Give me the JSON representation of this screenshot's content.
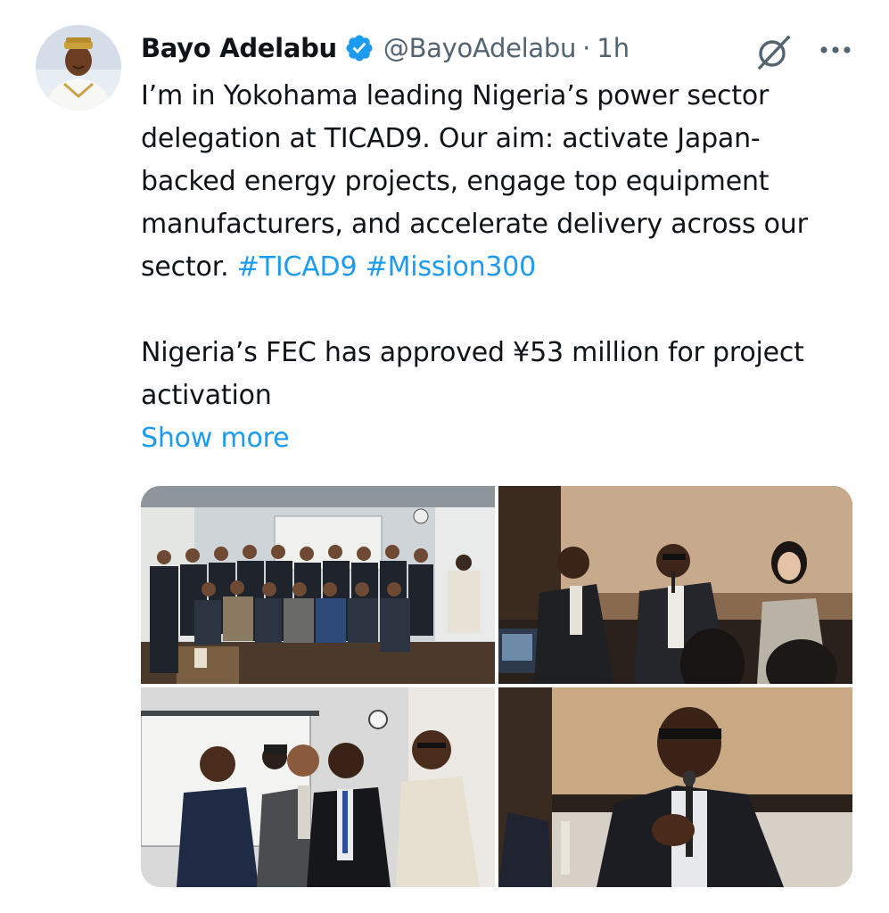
{
  "author": {
    "name": "Bayo Adelabu",
    "handle": "@BayoAdelabu",
    "separator": "·",
    "time": "1h",
    "avatar_icon": "profile-photo",
    "verified_icon": "verified-badge-icon"
  },
  "colors": {
    "accent": "#1d9bf0",
    "text": "#0f1419",
    "muted": "#536471"
  },
  "tweet": {
    "paragraph1_text": "I’m in Yokohama leading Nigeria’s power sector delegation at TICAD9. Our aim: activate Japan-backed energy projects, engage top equipment manufacturers, and accelerate delivery across our sector. ",
    "hashtags": [
      "#TICAD9",
      "#Mission300"
    ],
    "paragraph2": "Nigeria’s FEC has approved ¥53 million for project activation",
    "show_more": "Show more"
  },
  "actions": {
    "grok_icon": "grok-icon",
    "more_icon": "more-options-icon"
  },
  "media": {
    "count": 4,
    "photos": [
      {
        "name": "group-photo",
        "description_icon": "photo"
      },
      {
        "name": "panel-photo",
        "description_icon": "photo"
      },
      {
        "name": "four-men-photo",
        "description_icon": "photo"
      },
      {
        "name": "speaker-photo",
        "description_icon": "photo"
      }
    ]
  }
}
